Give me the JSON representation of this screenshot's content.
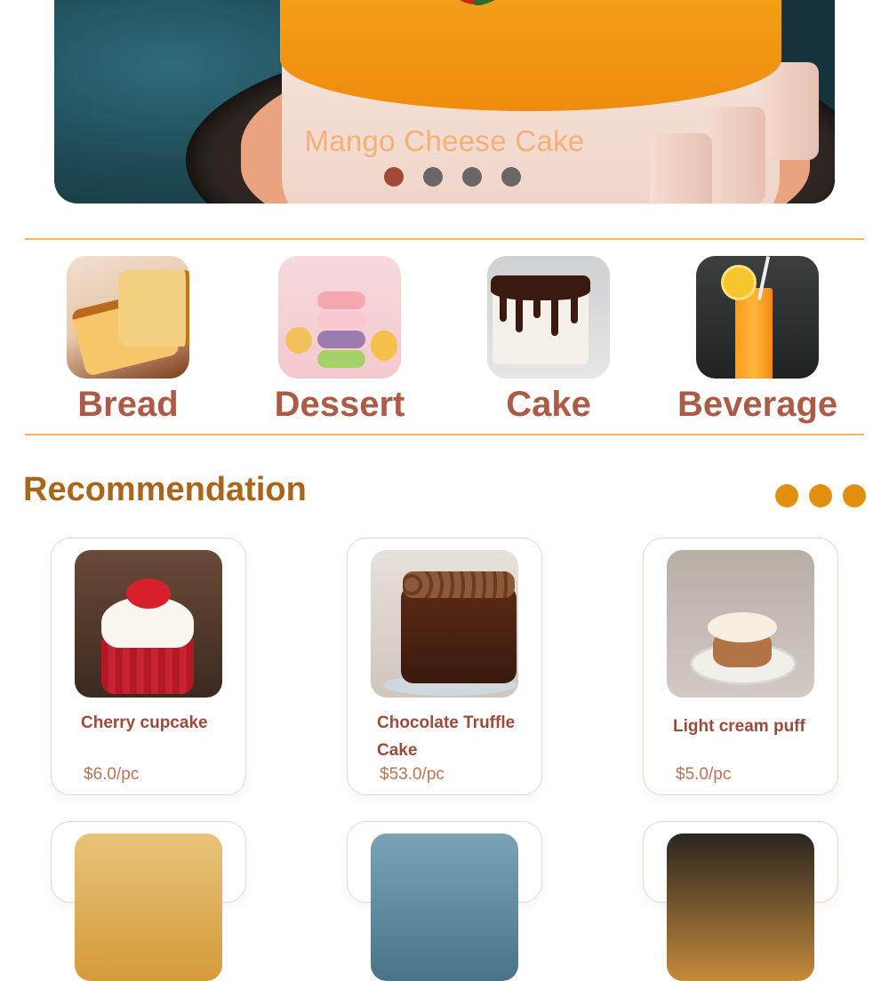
{
  "hero": {
    "caption": "Mango Cheese Cake",
    "slide_count": 4,
    "active_slide": 1
  },
  "categories": [
    {
      "label": "Bread",
      "icon": "bread-image"
    },
    {
      "label": "Dessert",
      "icon": "macaron-image"
    },
    {
      "label": "Cake",
      "icon": "cake-image"
    },
    {
      "label": "Beverage",
      "icon": "orange-juice-image"
    }
  ],
  "recommendation": {
    "title": "Recommendation",
    "items": [
      {
        "name": "Cherry cupcake",
        "price": "$6.0/pc"
      },
      {
        "name": "Chocolate Truffle Cake",
        "price": "$53.0/pc"
      },
      {
        "name": "Light cream puff",
        "price": "$5.0/pc"
      }
    ]
  },
  "colors": {
    "accent": "#e28f0e",
    "category_label": "#ad5b47",
    "title": "#a9661a",
    "divider": "#f1b765"
  }
}
